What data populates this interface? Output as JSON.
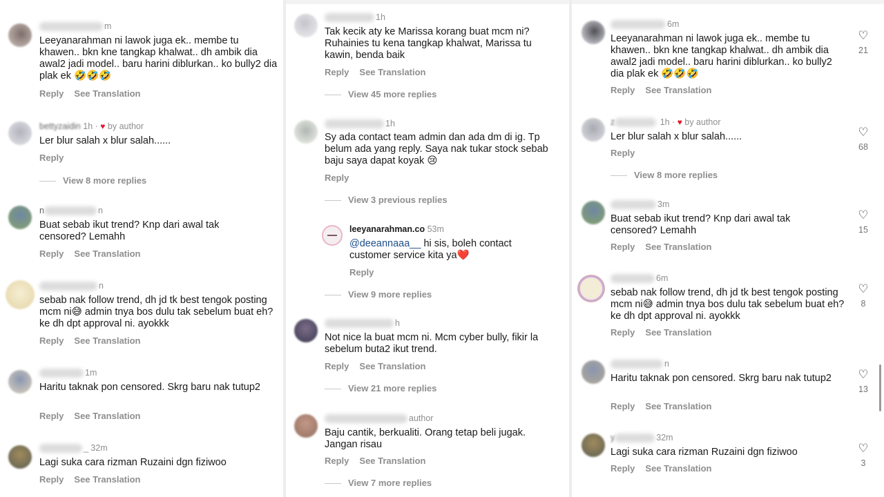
{
  "colors": {
    "text": "#1a1a1a",
    "muted": "#8e8e8e",
    "mention": "#1d4e89",
    "like_red": "#e0192d"
  },
  "left": {
    "comments": [
      {
        "time": "m",
        "text": "Leeyanarahman ni lawok juga ek.. membe tu khawen.. bkn kne tangkap khalwat.. dh ambik dia awal2 jadi model.. baru harini diblurkan.. ko bully2 dia plak ek 🤣🤣🤣",
        "reply": "Reply",
        "translate": "See Translation"
      },
      {
        "name_partial": "bettyzaidin",
        "time": "1h ·",
        "liked_by": "by author",
        "text": "Ler blur salah x blur salah......",
        "reply": "Reply",
        "view_replies": "View 8 more replies"
      },
      {
        "name_partial": "n",
        "time": "n",
        "text": "Buat sebab ikut trend? Knp dari awal tak censored? Lemahh",
        "reply": "Reply",
        "translate": "See Translation"
      },
      {
        "time": "n",
        "text": "sebab nak follow trend, dh jd tk best tengok posting mcm ni😅 admin tnya bos dulu tak sebelum buat eh? ke dh dpt approval ni. ayokkk",
        "reply": "Reply",
        "translate": "See Translation"
      },
      {
        "time": "1m",
        "text": "Haritu taknak pon censored. Skrg baru nak tutup2",
        "reply": "Reply",
        "translate": "See Translation"
      },
      {
        "time": "_ 32m",
        "text": "Lagi suka cara rizman Ruzaini dgn fiziwoo",
        "reply": "Reply",
        "translate": "See Translation"
      }
    ]
  },
  "middle": {
    "comments": [
      {
        "time": "1h",
        "text": "Tak kecik aty ke Marissa korang buat mcm ni? Ruhainies tu kena tangkap khalwat, Marissa tu kawin, benda baik",
        "reply": "Reply",
        "translate": "See Translation",
        "view_replies": "View 45 more replies"
      },
      {
        "time": "1h",
        "text": "Sy ada contact team admin dan ada dm di ig. Tp belum ada yang reply. Saya nak tukar stock sebab baju saya dapat koyak 😢",
        "reply": "Reply",
        "view_replies": "View 3 previous replies"
      },
      {
        "name": "leeyanarahman.co",
        "time": "53m",
        "mention": "@deeannaaa__",
        "text": " hi sis, boleh contact customer service kita ya❤️",
        "reply": "Reply",
        "view_replies": "View 9 more replies"
      },
      {
        "time": "h",
        "text": "Not nice la buat mcm ni. Mcm cyber bully, fikir la sebelum buta2 ikut trend.",
        "reply": "Reply",
        "translate": "See Translation",
        "view_replies": "View 21 more replies"
      },
      {
        "time": "author",
        "text": "Baju cantik, berkualiti. Orang tetap beli jugak. Jangan risau",
        "reply": "Reply",
        "translate": "See Translation",
        "view_replies": "View 7 more replies"
      }
    ]
  },
  "right": {
    "comments": [
      {
        "time": "6m",
        "text": "Leeyanarahman ni lawok juga ek.. membe tu khawen.. bkn kne tangkap khalwat.. dh ambik dia awal2 jadi model.. baru harini diblurkan.. ko bully2 dia plak ek 🤣🤣🤣",
        "reply": "Reply",
        "translate": "See Translation",
        "likes": "21"
      },
      {
        "name_partial": "z",
        "time": "1h ·",
        "liked_by": "by author",
        "text": "Ler blur salah x blur salah......",
        "reply": "Reply",
        "likes": "68",
        "view_replies": "View 8 more replies"
      },
      {
        "time": "3m",
        "text": "Buat sebab ikut trend? Knp dari awal tak censored? Lemahh",
        "reply": "Reply",
        "translate": "See Translation",
        "likes": "15"
      },
      {
        "time": "6m",
        "text": "sebab nak follow trend, dh jd tk best tengok posting mcm ni😅 admin tnya bos dulu tak sebelum buat eh? ke dh dpt approval ni. ayokkk",
        "reply": "Reply",
        "translate": "See Translation",
        "likes": "8"
      },
      {
        "time": "n",
        "text": "Haritu taknak pon censored. Skrg baru nak tutup2",
        "reply": "Reply",
        "translate": "See Translation",
        "likes": "13"
      },
      {
        "name_partial": "y",
        "time": "32m",
        "text": "Lagi suka cara rizman Ruzaini dgn fiziwoo",
        "reply": "Reply",
        "translate": "See Translation",
        "likes": "3"
      }
    ]
  }
}
